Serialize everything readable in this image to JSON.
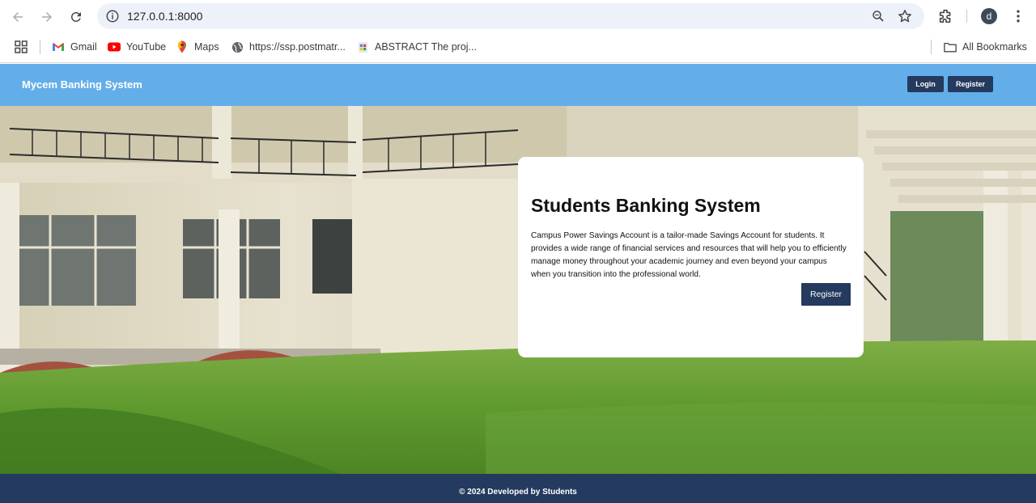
{
  "browser": {
    "url": "127.0.0.1:8000",
    "profile_initial": "d",
    "bookmarks": [
      {
        "label": "Gmail",
        "icon": "gmail-icon"
      },
      {
        "label": "YouTube",
        "icon": "youtube-icon"
      },
      {
        "label": "Maps",
        "icon": "maps-icon"
      },
      {
        "label": "https://ssp.postmatr...",
        "icon": "globe-icon"
      },
      {
        "label": "ABSTRACT The proj...",
        "icon": "document-icon"
      }
    ],
    "all_bookmarks_label": "All Bookmarks"
  },
  "site": {
    "brand": "Mycem Banking System",
    "nav": {
      "login_label": "Login",
      "register_label": "Register"
    },
    "accent_color": "#63aee9",
    "primary_color": "#243a5e"
  },
  "hero": {
    "title": "Students Banking System",
    "description": "Campus Power Savings Account is a tailor-made Savings Account for students. It provides a wide range of financial services and resources that will help you to efficiently manage money throughout your academic journey and even beyond your campus when you transition into the professional world.",
    "register_label": "Register"
  },
  "footer": {
    "text": "© 2024 Developed by Students"
  }
}
